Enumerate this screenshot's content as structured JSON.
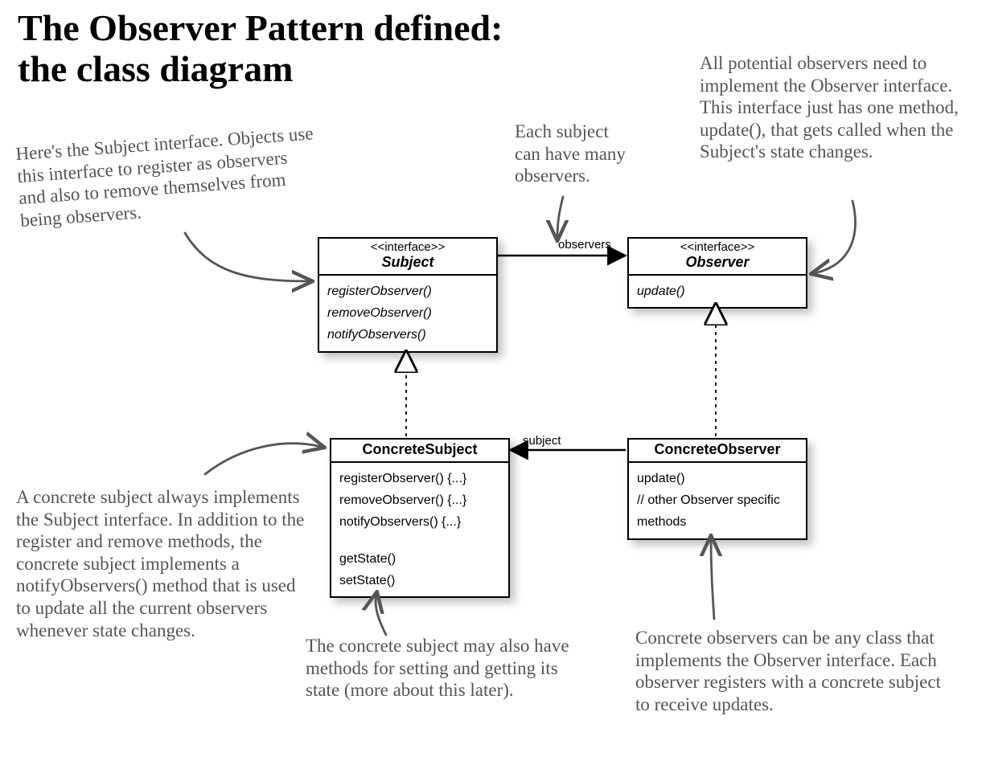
{
  "title": "The Observer Pattern defined:\nthe class diagram",
  "annotations": {
    "subject_interface": "Here's the Subject interface. Objects use this interface to register as observers and also to remove themselves from being observers.",
    "each_subject": "Each subject\ncan have many\nobservers.",
    "observer_interface": "All potential observers need to implement the Observer interface.  This interface just has one method, update(), that gets called when the Subject's state changes.",
    "concrete_subject": "A concrete subject always implements the Subject interface.  In addition to the register and remove methods, the concrete subject implements a notifyObservers() method that is used to update all the current observers whenever state changes.",
    "getset": "The concrete subject may also have methods for setting and getting its state (more about this later).",
    "concrete_observer": "Concrete observers can be any class that implements the Observer interface.  Each observer registers with a concrete subject to receive updates."
  },
  "classes": {
    "subject": {
      "stereo": "<<interface>>",
      "name": "Subject",
      "m1": "registerObserver()",
      "m2": "removeObserver()",
      "m3": "notifyObservers()"
    },
    "observer": {
      "stereo": "<<interface>>",
      "name": "Observer",
      "m1": "update()"
    },
    "concreteSubject": {
      "name": "ConcreteSubject",
      "m1": "registerObserver() {...}",
      "m2": "removeObserver() {...}",
      "m3": "notifyObservers() {...}",
      "m4": "getState()",
      "m5": "setState()"
    },
    "concreteObserver": {
      "name": "ConcreteObserver",
      "m1": "update()",
      "m2": "// other Observer specific",
      "m3": "methods"
    }
  },
  "relations": {
    "observers": "observers",
    "subject": "subject"
  }
}
